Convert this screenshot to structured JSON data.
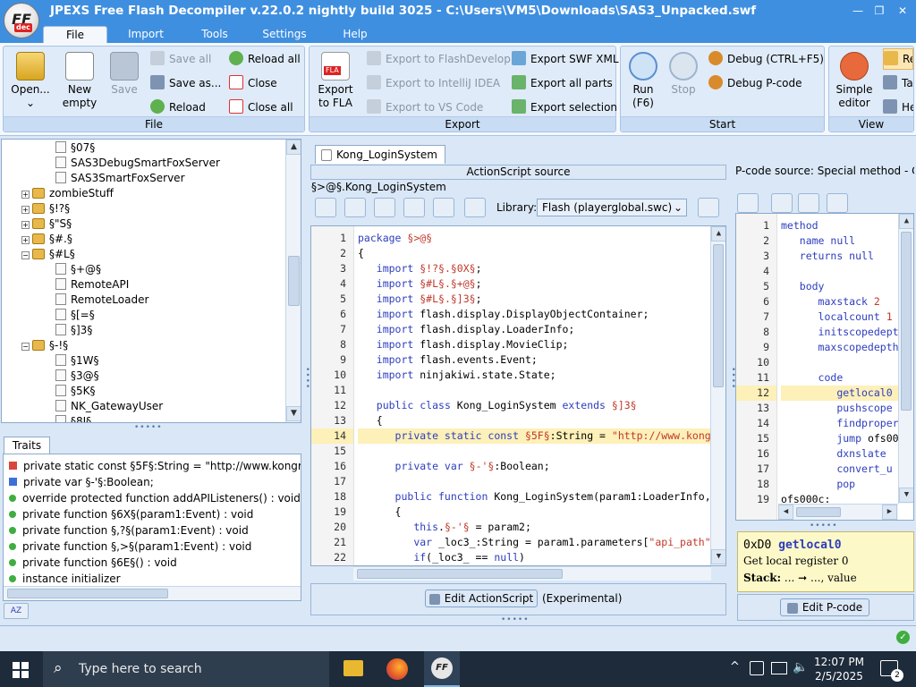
{
  "window": {
    "title": "JPEXS Free Flash Decompiler v.22.0.2 nightly build 3025 - C:\\Users\\VM5\\Downloads\\SAS3_Unpacked.swf",
    "logo_text": "FF",
    "logo_sub": "dec",
    "min": "—",
    "restore": "❐",
    "close": "✕"
  },
  "menu_tabs": [
    "File",
    "Import",
    "Tools",
    "Settings",
    "Help"
  ],
  "ribbon": {
    "file": {
      "label": "File",
      "open": "Open...",
      "new_empty_1": "New",
      "new_empty_2": "empty",
      "save": "Save",
      "save_all": "Save all",
      "save_as": "Save as...",
      "reload": "Reload",
      "reload_all": "Reload all",
      "close": "Close",
      "close_all": "Close all"
    },
    "export": {
      "label": "Export",
      "fla_icon": "FLA",
      "export_fla_1": "Export",
      "export_fla_2": "to FLA",
      "flashdevelop": "Export to FlashDevelop",
      "intellij": "Export to IntelliJ IDEA",
      "vscode": "Export to VS Code",
      "swf_xml": "Export SWF XML",
      "all_parts": "Export all parts",
      "selection": "Export selection"
    },
    "start": {
      "label": "Start",
      "run_1": "Run",
      "run_2": "(F6)",
      "stop": "Stop",
      "debug": "Debug (CTRL+F5)",
      "debug_pcode": "Debug P-code"
    },
    "view": {
      "label": "View",
      "simple_1": "Simple",
      "simple_2": "editor",
      "re": "Re",
      "ta": "Ta",
      "he": "He"
    }
  },
  "tree": {
    "items": [
      {
        "label": "§07§",
        "depth": 3,
        "kind": "file"
      },
      {
        "label": "SAS3DebugSmartFoxServer",
        "depth": 3,
        "kind": "file"
      },
      {
        "label": "SAS3SmartFoxServer",
        "depth": 3,
        "kind": "file"
      },
      {
        "label": "zombieStuff",
        "depth": 1,
        "kind": "pkg",
        "expander": "+"
      },
      {
        "label": "§!?§",
        "depth": 1,
        "kind": "pkg",
        "expander": "+"
      },
      {
        "label": "§\"S§",
        "depth": 1,
        "kind": "pkg",
        "expander": "+"
      },
      {
        "label": "§#.§",
        "depth": 1,
        "kind": "pkg",
        "expander": "+"
      },
      {
        "label": "§#L§",
        "depth": 1,
        "kind": "pkg",
        "expander": "−"
      },
      {
        "label": "§+@§",
        "depth": 2,
        "kind": "file"
      },
      {
        "label": "RemoteAPI",
        "depth": 2,
        "kind": "file"
      },
      {
        "label": "RemoteLoader",
        "depth": 2,
        "kind": "file"
      },
      {
        "label": "§[=§",
        "depth": 2,
        "kind": "file"
      },
      {
        "label": "§]3§",
        "depth": 2,
        "kind": "file"
      },
      {
        "label": "§-!§",
        "depth": 1,
        "kind": "pkg",
        "expander": "−"
      },
      {
        "label": "§1W§",
        "depth": 2,
        "kind": "file"
      },
      {
        "label": "§3@§",
        "depth": 2,
        "kind": "file"
      },
      {
        "label": "§5K§",
        "depth": 2,
        "kind": "file"
      },
      {
        "label": "NK_GatewayUser",
        "depth": 2,
        "kind": "file"
      },
      {
        "label": "§8I§",
        "depth": 2,
        "kind": "file"
      }
    ]
  },
  "traits": {
    "tab": "Traits",
    "sort_icon": "AZ",
    "items": [
      {
        "text": "private static const §5F§:String = \"http://www.kongreg",
        "kind": "const"
      },
      {
        "text": "private var §-'§:Boolean;",
        "kind": "var"
      },
      {
        "text": "override protected function addAPIListeners() : void",
        "kind": "func"
      },
      {
        "text": "private function §6X§(param1:Event) : void",
        "kind": "func"
      },
      {
        "text": "private function §,?§(param1:Event) : void",
        "kind": "func"
      },
      {
        "text": "private function §,>§(param1:Event) : void",
        "kind": "func"
      },
      {
        "text": "private function §6E§() : void",
        "kind": "func"
      },
      {
        "text": "instance initializer",
        "kind": "func"
      }
    ]
  },
  "editor": {
    "tab": "Kong_LoginSystem",
    "header": "ActionScript source",
    "breadcrumb": "§>@§.Kong_LoginSystem",
    "library_label": "Library:",
    "library_value": "Flash (playerglobal.swc)",
    "highlight_line": 14,
    "lines": [
      [
        {
          "t": "package ",
          "c": "kw"
        },
        {
          "t": "§>@§",
          "c": "str"
        }
      ],
      [
        {
          "t": "{"
        }
      ],
      [
        {
          "t": "   "
        },
        {
          "t": "import ",
          "c": "kw"
        },
        {
          "t": "§!?§.§0X§",
          "c": "str"
        },
        {
          "t": ";"
        }
      ],
      [
        {
          "t": "   "
        },
        {
          "t": "import ",
          "c": "kw"
        },
        {
          "t": "§#L§.§+@§",
          "c": "str"
        },
        {
          "t": ";"
        }
      ],
      [
        {
          "t": "   "
        },
        {
          "t": "import ",
          "c": "kw"
        },
        {
          "t": "§#L§.§]3§",
          "c": "str"
        },
        {
          "t": ";"
        }
      ],
      [
        {
          "t": "   "
        },
        {
          "t": "import ",
          "c": "kw"
        },
        {
          "t": "flash.display.DisplayObjectContainer;"
        }
      ],
      [
        {
          "t": "   "
        },
        {
          "t": "import ",
          "c": "kw"
        },
        {
          "t": "flash.display.LoaderInfo;"
        }
      ],
      [
        {
          "t": "   "
        },
        {
          "t": "import ",
          "c": "kw"
        },
        {
          "t": "flash.display.MovieClip;"
        }
      ],
      [
        {
          "t": "   "
        },
        {
          "t": "import ",
          "c": "kw"
        },
        {
          "t": "flash.events.Event;"
        }
      ],
      [
        {
          "t": "   "
        },
        {
          "t": "import ",
          "c": "kw"
        },
        {
          "t": "ninjakiwi.state.State;"
        }
      ],
      [
        {
          "t": ""
        }
      ],
      [
        {
          "t": "   "
        },
        {
          "t": "public class ",
          "c": "kw"
        },
        {
          "t": "Kong_LoginSystem "
        },
        {
          "t": "extends ",
          "c": "kw"
        },
        {
          "t": "§]3§",
          "c": "str"
        }
      ],
      [
        {
          "t": "   {"
        }
      ],
      [
        {
          "t": "      "
        },
        {
          "t": "private static const ",
          "c": "kw"
        },
        {
          "t": "§5F§",
          "c": "str"
        },
        {
          "t": ":String = "
        },
        {
          "t": "\"http://www.kong",
          "c": "str"
        }
      ],
      [
        {
          "t": ""
        }
      ],
      [
        {
          "t": "      "
        },
        {
          "t": "private var ",
          "c": "kw"
        },
        {
          "t": "§-'§",
          "c": "str"
        },
        {
          "t": ":Boolean;"
        }
      ],
      [
        {
          "t": ""
        }
      ],
      [
        {
          "t": "      "
        },
        {
          "t": "public function ",
          "c": "kw"
        },
        {
          "t": "Kong_LoginSystem(param1:LoaderInfo,"
        }
      ],
      [
        {
          "t": "      {"
        }
      ],
      [
        {
          "t": "         "
        },
        {
          "t": "this",
          "c": "kw"
        },
        {
          "t": "."
        },
        {
          "t": "§-'§",
          "c": "str"
        },
        {
          "t": " = param2;"
        }
      ],
      [
        {
          "t": "         "
        },
        {
          "t": "var ",
          "c": "kw"
        },
        {
          "t": "_loc3_:String = param1.parameters["
        },
        {
          "t": "\"api_path\"",
          "c": "str"
        }
      ],
      [
        {
          "t": "         "
        },
        {
          "t": "if",
          "c": "kw"
        },
        {
          "t": "(_loc3_ == "
        },
        {
          "t": "null",
          "c": "kw"
        },
        {
          "t": ")"
        }
      ]
    ],
    "edit_button": "Edit ActionScript",
    "experimental": "(Experimental)"
  },
  "pcode": {
    "header": "P-code source: Special method - C...",
    "highlight_line": 12,
    "lines": [
      [
        {
          "t": "method",
          "c": "kw"
        }
      ],
      [
        {
          "t": "   "
        },
        {
          "t": "name ",
          "c": "kw"
        },
        {
          "t": "null",
          "c": "kw"
        }
      ],
      [
        {
          "t": "   "
        },
        {
          "t": "returns ",
          "c": "kw"
        },
        {
          "t": "null",
          "c": "kw"
        }
      ],
      [
        {
          "t": ""
        }
      ],
      [
        {
          "t": "   "
        },
        {
          "t": "body",
          "c": "kw"
        }
      ],
      [
        {
          "t": "      "
        },
        {
          "t": "maxstack ",
          "c": "kw"
        },
        {
          "t": "2",
          "c": "str"
        }
      ],
      [
        {
          "t": "      "
        },
        {
          "t": "localcount ",
          "c": "kw"
        },
        {
          "t": "1",
          "c": "str"
        }
      ],
      [
        {
          "t": "      "
        },
        {
          "t": "initscopedept",
          "c": "kw"
        }
      ],
      [
        {
          "t": "      "
        },
        {
          "t": "maxscopedepth",
          "c": "kw"
        }
      ],
      [
        {
          "t": ""
        }
      ],
      [
        {
          "t": "      "
        },
        {
          "t": "code",
          "c": "kw"
        }
      ],
      [
        {
          "t": "         "
        },
        {
          "t": "getlocal0",
          "c": "kw"
        }
      ],
      [
        {
          "t": "         "
        },
        {
          "t": "pushscope",
          "c": "kw"
        }
      ],
      [
        {
          "t": "         "
        },
        {
          "t": "findproper",
          "c": "kw"
        }
      ],
      [
        {
          "t": "         "
        },
        {
          "t": "jump ",
          "c": "kw"
        },
        {
          "t": "ofs00"
        }
      ],
      [
        {
          "t": "         "
        },
        {
          "t": "dxnslate",
          "c": "kw"
        }
      ],
      [
        {
          "t": "         "
        },
        {
          "t": "convert_u",
          "c": "kw"
        }
      ],
      [
        {
          "t": "         "
        },
        {
          "t": "pop",
          "c": "kw"
        }
      ],
      [
        {
          "t": "ofs000c:"
        }
      ]
    ],
    "doc_opcode": "0xD0",
    "doc_name": "getlocal0",
    "doc_desc": "Get local register 0",
    "doc_stack_label": "Stack:",
    "doc_stack": "... ➞ ..., value",
    "edit_button": "Edit P-code"
  },
  "taskbar": {
    "search": "Type here to search",
    "time": "12:07 PM",
    "date": "2/5/2025",
    "notif_count": "2"
  }
}
